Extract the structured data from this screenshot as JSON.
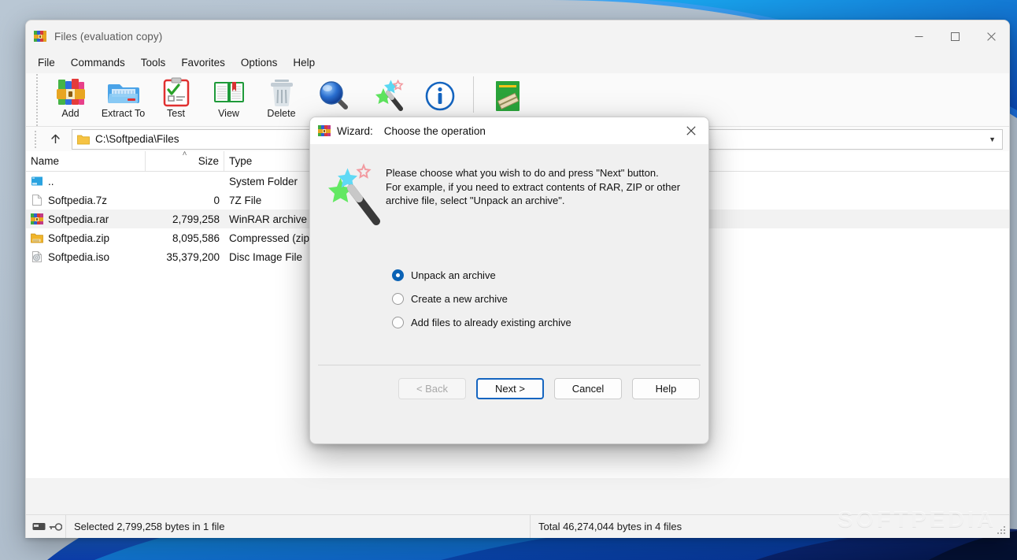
{
  "window": {
    "title": "Files (evaluation copy)",
    "app_icon": "winrar-books-icon",
    "controls": {
      "minimize": "—",
      "maximize": "□",
      "close": "✕"
    }
  },
  "menubar": {
    "items": [
      {
        "label": "File"
      },
      {
        "label": "Commands"
      },
      {
        "label": "Tools"
      },
      {
        "label": "Favorites"
      },
      {
        "label": "Options"
      },
      {
        "label": "Help"
      }
    ]
  },
  "toolbar": {
    "buttons": [
      {
        "label": "Add",
        "icon": "add-books-icon"
      },
      {
        "label": "Extract To",
        "icon": "extract-folder-icon"
      },
      {
        "label": "Test",
        "icon": "test-clipboard-icon"
      },
      {
        "label": "View",
        "icon": "view-book-icon"
      },
      {
        "label": "Delete",
        "icon": "delete-trash-icon"
      },
      {
        "label": "",
        "icon": "find-magnifier-icon"
      },
      {
        "label": "",
        "icon": "wizard-wand-icon"
      },
      {
        "label": "",
        "icon": "info-icon"
      },
      {
        "label": "",
        "icon": "repair-icon"
      }
    ]
  },
  "addressbar": {
    "up_icon": "arrow-up-icon",
    "folder_icon": "folder-icon",
    "path": "C:\\Softpedia\\Files",
    "dropdown_icon": "chevron-down-icon"
  },
  "filelist": {
    "columns": [
      {
        "key": "name",
        "label": "Name"
      },
      {
        "key": "size",
        "label": "Size",
        "sort": "˄"
      },
      {
        "key": "type",
        "label": "Type"
      },
      {
        "key": "rest",
        "label": ""
      }
    ],
    "rows": [
      {
        "icon": "parent-folder-icon",
        "name": "..",
        "size": "",
        "type": "System Folder"
      },
      {
        "icon": "generic-file-icon",
        "name": "Softpedia.7z",
        "size": "0",
        "type": "7Z File"
      },
      {
        "icon": "rar-archive-icon",
        "name": "Softpedia.rar",
        "size": "2,799,258",
        "type": "WinRAR archive",
        "selected": true
      },
      {
        "icon": "zip-archive-icon",
        "name": "Softpedia.zip",
        "size": "8,095,586",
        "type": "Compressed (zipped) Folder"
      },
      {
        "icon": "iso-disc-icon",
        "name": "Softpedia.iso",
        "size": "35,379,200",
        "type": "Disc Image File"
      }
    ]
  },
  "statusbar": {
    "icons": [
      "drive-icon",
      "key-icon"
    ],
    "selected_text": "Selected 2,799,258 bytes in 1 file",
    "total_text": "Total 46,274,044 bytes in 4 files"
  },
  "watermark": {
    "text": "SOFTPEDIA"
  },
  "wizard": {
    "icon": "winrar-books-icon",
    "title_prefix": "Wizard:",
    "title": "Choose the operation",
    "close_icon": "✕",
    "wand_icon": "magic-wand-icon",
    "description_lines": [
      "Please choose what you wish to do and press \"Next\" button.",
      "For example, if you need to extract contents of RAR, ZIP or other",
      "archive file, select \"Unpack an archive\"."
    ],
    "options": [
      {
        "label": "Unpack an archive",
        "selected": true
      },
      {
        "label": "Create a new archive",
        "selected": false
      },
      {
        "label": "Add files to already existing archive",
        "selected": false
      }
    ],
    "buttons": [
      {
        "label": "< Back",
        "state": "disabled"
      },
      {
        "label": "Next >",
        "state": "default"
      },
      {
        "label": "Cancel",
        "state": "normal"
      },
      {
        "label": "Help",
        "state": "normal"
      }
    ]
  },
  "colors": {
    "accent": "#1565c0",
    "radio_on": "#0a62b5",
    "window_bg": "#f3f3f3",
    "dialog_bg": "#f0f0f0",
    "desktop": "#b2c2d2"
  }
}
